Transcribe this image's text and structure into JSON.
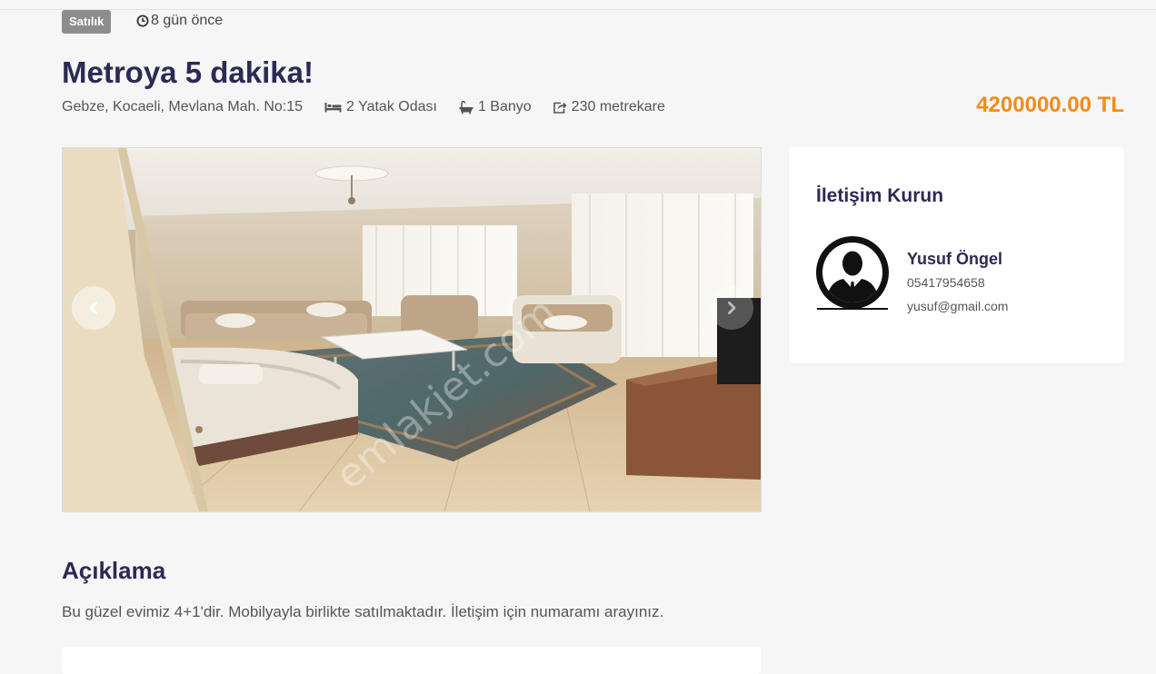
{
  "listing": {
    "status_badge": "Satılık",
    "posted_ago": "8 gün önce",
    "title": "Metroya 5 dakika!",
    "address": "Gebze, Kocaeli, Mevlana Mah. No:15",
    "bedrooms": "2 Yatak Odası",
    "bathrooms": "1 Banyo",
    "area": "230 metrekare",
    "price": "4200000.00 TL"
  },
  "gallery": {
    "watermark": "emlakjet.com"
  },
  "contact": {
    "heading": "İletişim Kurun",
    "agent_name": "Yusuf Öngel",
    "agent_phone": "05417954658",
    "agent_email": "yusuf@gmail.com"
  },
  "description": {
    "heading": "Açıklama",
    "text": "Bu güzel evimiz 4+1'dir. Mobilyayla birlikte satılmaktadır. İletişim için numaramı arayınız."
  },
  "colors": {
    "title": "#2c2a54",
    "price": "#f08c1a",
    "badge": "#8d8d8d",
    "background": "#f6f6f6"
  },
  "icons": {
    "time": "clock-icon",
    "bed": "bed-icon",
    "bath": "bath-icon",
    "area": "share-icon",
    "prev": "chevron-left-icon",
    "avatar": "user-silhouette-icon"
  }
}
